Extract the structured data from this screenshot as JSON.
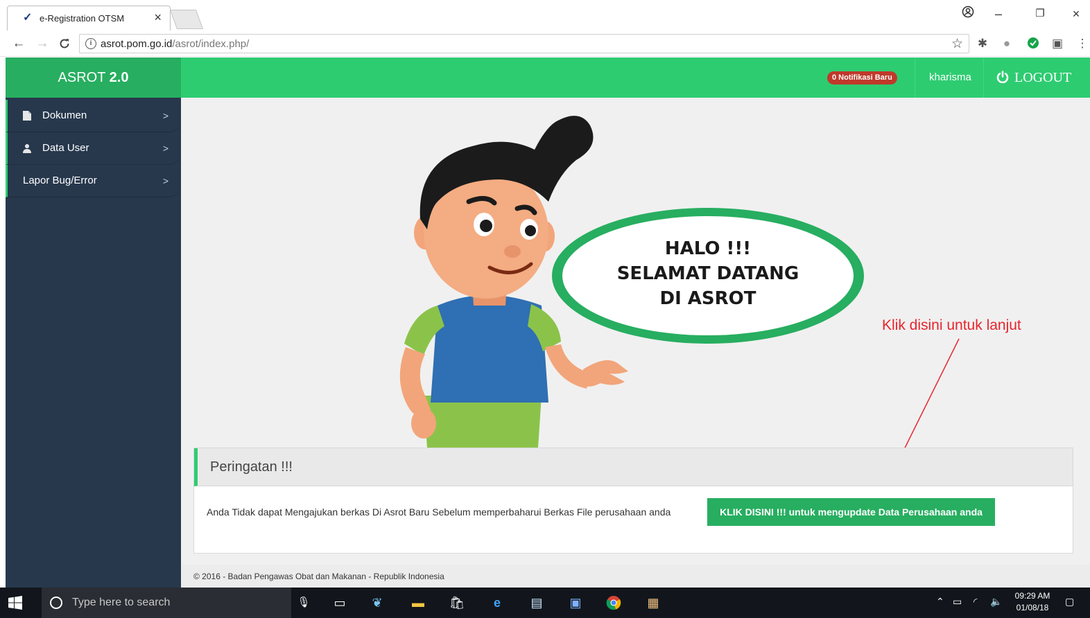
{
  "browser": {
    "tab_title": "e-Registration OTSM",
    "tab_close": "×",
    "url_host": "asrot.pom.go.id",
    "url_path": "/asrot/index.php/",
    "info_symbol": "i",
    "window_minimize": "–",
    "window_restore": "❐",
    "window_close": "×"
  },
  "app": {
    "brand_prefix": "ASROT",
    "brand_version": "2.0",
    "sidebar": {
      "items": [
        {
          "label": "Dokumen",
          "icon": "document-icon"
        },
        {
          "label": "Data User",
          "icon": "user-icon"
        },
        {
          "label": "Lapor Bug/Error",
          "icon": null
        }
      ]
    },
    "topnav": {
      "notification_badge": "0 Notifikasi Baru",
      "user": "kharisma",
      "logout": "LOGOUT"
    },
    "hero": {
      "bubble_line1": "HALO !!!",
      "bubble_line2": "SELAMAT DATANG",
      "bubble_line3": "DI ASROT"
    },
    "annotation": "Klik disini untuk lanjut",
    "warning_panel": {
      "title": "Peringatan !!!",
      "message": "Anda Tidak dapat Mengajukan berkas Di Asrot Baru Sebelum memperbaharui Berkas File perusahaan anda",
      "button": "KLIK DISINI !!! untuk mengupdate Data Perusahaan anda"
    },
    "footer": "© 2016 - Badan Pengawas Obat dan Makanan - Republik Indonesia"
  },
  "taskbar": {
    "search_placeholder": "Type here to search",
    "time": "09:29 AM",
    "date": "01/08/18"
  },
  "colors": {
    "brand_green": "#27ae60",
    "topnav_green": "#2ecc71",
    "sidebar_navy": "#27384d",
    "badge_red": "#c0392b",
    "annotation_red": "#e8242c"
  }
}
